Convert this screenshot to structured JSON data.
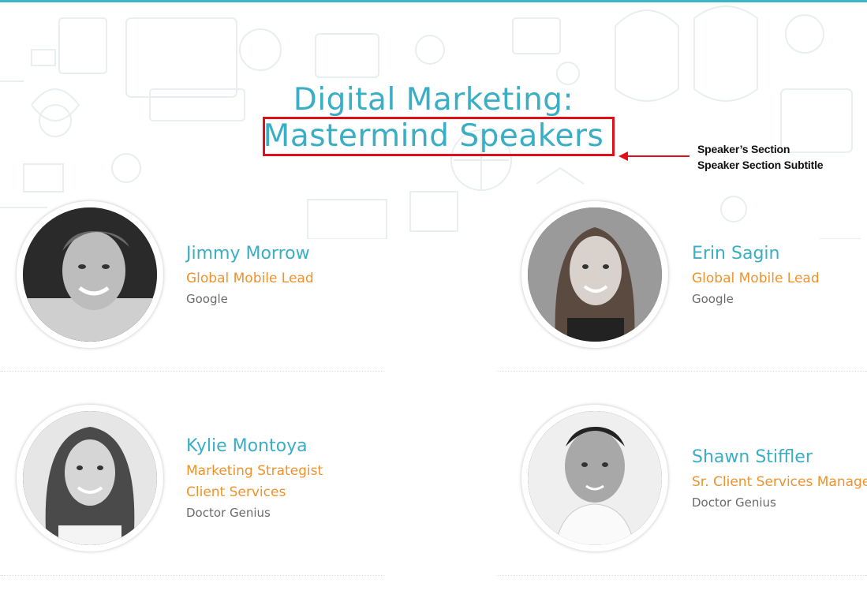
{
  "section": {
    "title_line1": "Digital Marketing:",
    "title_line2": "Mastermind Speakers",
    "accent_color": "#3aaec4",
    "role_color": "#f0922c"
  },
  "annotation": {
    "line1": "Speaker’s Section",
    "line2": "Speaker Section Subtitle",
    "box_color": "#e0101a"
  },
  "speakers": [
    {
      "name": "Jimmy Morrow",
      "role_lines": [
        "Global Mobile Lead"
      ],
      "company": "Google",
      "photo_icon": "male-portrait"
    },
    {
      "name": "Erin Sagin",
      "role_lines": [
        "Global Mobile Lead"
      ],
      "company": "Google",
      "photo_icon": "female-portrait"
    },
    {
      "name": "Kylie Montoya",
      "role_lines": [
        "Marketing Strategist",
        "Client Services"
      ],
      "company": "Doctor Genius",
      "photo_icon": "female-portrait"
    },
    {
      "name": "Shawn Stiffler",
      "role_lines": [
        "Sr. Client Services Manager"
      ],
      "company": "Doctor Genius",
      "photo_icon": "male-portrait"
    }
  ]
}
